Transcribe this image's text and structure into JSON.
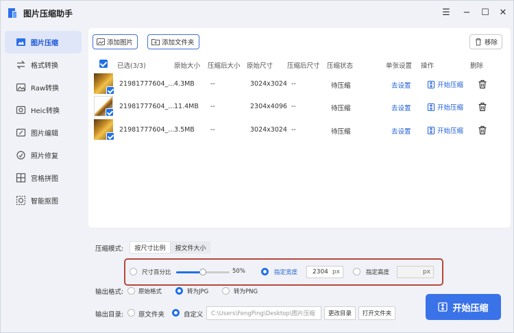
{
  "window": {
    "title": "图片压缩助手",
    "controls": {
      "menu": "☰",
      "minimize": "−",
      "maximize": "☐",
      "close": "✕"
    }
  },
  "sidebar": {
    "items": [
      {
        "label": "图片压缩",
        "icon": "compress-icon",
        "active": true
      },
      {
        "label": "格式转换",
        "icon": "convert-icon"
      },
      {
        "label": "Raw转换",
        "icon": "raw-icon"
      },
      {
        "label": "Heic转换",
        "icon": "heic-icon"
      },
      {
        "label": "图片编辑",
        "icon": "edit-icon"
      },
      {
        "label": "照片修复",
        "icon": "repair-icon"
      },
      {
        "label": "宫格拼图",
        "icon": "grid-icon"
      },
      {
        "label": "智能抠图",
        "icon": "cutout-icon"
      }
    ]
  },
  "toolbar": {
    "add_image": "添加图片",
    "add_folder": "添加文件夹",
    "remove": "移除"
  },
  "table": {
    "headers": {
      "selected": "已选(3/3)",
      "orig_size": "原始大小",
      "comp_size": "压缩后大小",
      "orig_dim": "原始尺寸",
      "comp_dim": "压缩后尺寸",
      "status": "压缩状态",
      "single": "单张设置",
      "op": "操作",
      "delete": "删除"
    },
    "rows": [
      {
        "name": "21981777604_...",
        "orig_size": "4.3MB",
        "comp_size": "--",
        "orig_dim": "3024x3024",
        "comp_dim": "--",
        "status": "待压缩",
        "settings": "去设置",
        "action": "开始压缩"
      },
      {
        "name": "21981777604_...",
        "orig_size": "11.4MB",
        "comp_size": "--",
        "orig_dim": "2304x4096",
        "comp_dim": "--",
        "status": "待压缩",
        "settings": "去设置",
        "action": "开始压缩"
      },
      {
        "name": "21981777604_...",
        "orig_size": "3.5MB",
        "comp_size": "--",
        "orig_dim": "3024x3024",
        "comp_dim": "--",
        "status": "待压缩",
        "settings": "去设置",
        "action": "开始压缩"
      }
    ]
  },
  "compress": {
    "mode_label": "压缩模式:",
    "mode_tabs": [
      "按尺寸比例",
      "按文件大小"
    ],
    "size_percent_label": "尺寸百分比",
    "slider_value": 0.5,
    "slider_text": "50%",
    "fixed_width_label": "指定宽度",
    "width_value": "2304",
    "width_unit": "px",
    "fixed_height_label": "指定高度",
    "height_unit": "px"
  },
  "output_format": {
    "label": "输出格式:",
    "options": [
      "原始格式",
      "转为JPG",
      "转为PNG"
    ],
    "selected": "转为JPG"
  },
  "output_dir": {
    "label": "输出目录:",
    "options": [
      "原文件夹",
      "自定义"
    ],
    "selected": "自定义",
    "path": "C:\\Users\\FengPing\\Desktop\\图片压缩",
    "change_btn": "更改目录",
    "open_btn": "打开文件夹"
  },
  "start_button": "开始压缩",
  "colors": {
    "accent": "#1f6fe8",
    "highlight_border": "#b5473a"
  }
}
